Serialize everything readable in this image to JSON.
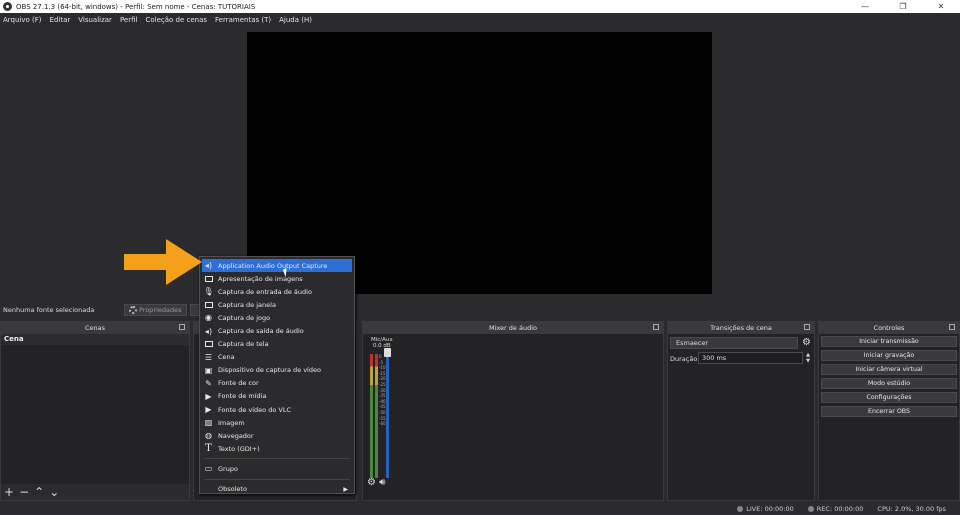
{
  "window": {
    "title": "OBS 27.1.3 (64-bit, windows) - Perfil: Sem nome - Cenas: TUTORIAIS",
    "controls": [
      "—",
      "❐",
      "✕"
    ]
  },
  "menubar": [
    "Arquivo (F)",
    "Editar",
    "Visualizar",
    "Perfil",
    "Coleção de cenas",
    "Ferramentas (T)",
    "Ajuda (H)"
  ],
  "sources": {
    "no_selection": "Nenhuma fonte selecionada",
    "properties_button": "Propriedades"
  },
  "docks": {
    "scenes": {
      "title": "Cenas",
      "items": [
        "Cena"
      ],
      "toolbar": [
        "+",
        "−",
        "⌃",
        "⌄"
      ]
    },
    "mixer": {
      "title": "Mixer de áudio",
      "channel_name": "Mic/Aux",
      "channel_level": "0.0 dB",
      "ticks": [
        "0",
        "-5",
        "-10",
        "-15",
        "-20",
        "-25",
        "-30",
        "-35",
        "-40",
        "-45",
        "-50",
        "-55",
        "-60"
      ]
    },
    "transitions": {
      "title": "Transições de cena",
      "selected": "Esmaecer",
      "duration_label": "Duração",
      "duration_value": "300 ms"
    },
    "controls": {
      "title": "Controles",
      "buttons": [
        "Iniciar transmissão",
        "Iniciar gravação",
        "Iniciar câmera virtual",
        "Modo estúdio",
        "Configurações",
        "Encerrar OBS"
      ]
    }
  },
  "context_menu": {
    "items": [
      {
        "label": "Application Audio Output Capture",
        "icon": "speaker-icon",
        "highlighted": true
      },
      {
        "label": "Apresentação de imagens",
        "icon": "slideshow-icon"
      },
      {
        "label": "Captura de entrada de áudio",
        "icon": "microphone-icon"
      },
      {
        "label": "Captura de janela",
        "icon": "window-icon"
      },
      {
        "label": "Captura de jogo",
        "icon": "gamepad-icon"
      },
      {
        "label": "Captura de saída de áudio",
        "icon": "speaker-icon"
      },
      {
        "label": "Captura de tela",
        "icon": "monitor-icon"
      },
      {
        "label": "Cena",
        "icon": "list-icon"
      },
      {
        "label": "Dispositivo de captura de vídeo",
        "icon": "camera-icon"
      },
      {
        "label": "Fonte de cor",
        "icon": "brush-icon"
      },
      {
        "label": "Fonte de mídia",
        "icon": "play-icon"
      },
      {
        "label": "Fonte de vídeo do VLC",
        "icon": "play-icon"
      },
      {
        "label": "Imagem",
        "icon": "image-icon"
      },
      {
        "label": "Navegador",
        "icon": "globe-icon"
      },
      {
        "label": "Texto (GDI+)",
        "icon": "text-icon"
      },
      {
        "label": "Grupo",
        "icon": "folder-icon"
      },
      {
        "label": "Obsoleto",
        "icon": "",
        "submenu": true
      }
    ]
  },
  "status": {
    "live": "LIVE: 00:00:00",
    "rec": "REC: 00:00:00",
    "cpu": "CPU: 2.0%, 30.00 fps"
  },
  "colors": {
    "highlight": "#2e6fd6",
    "arrow": "#f5a01a",
    "background": "#2b2b2e"
  }
}
